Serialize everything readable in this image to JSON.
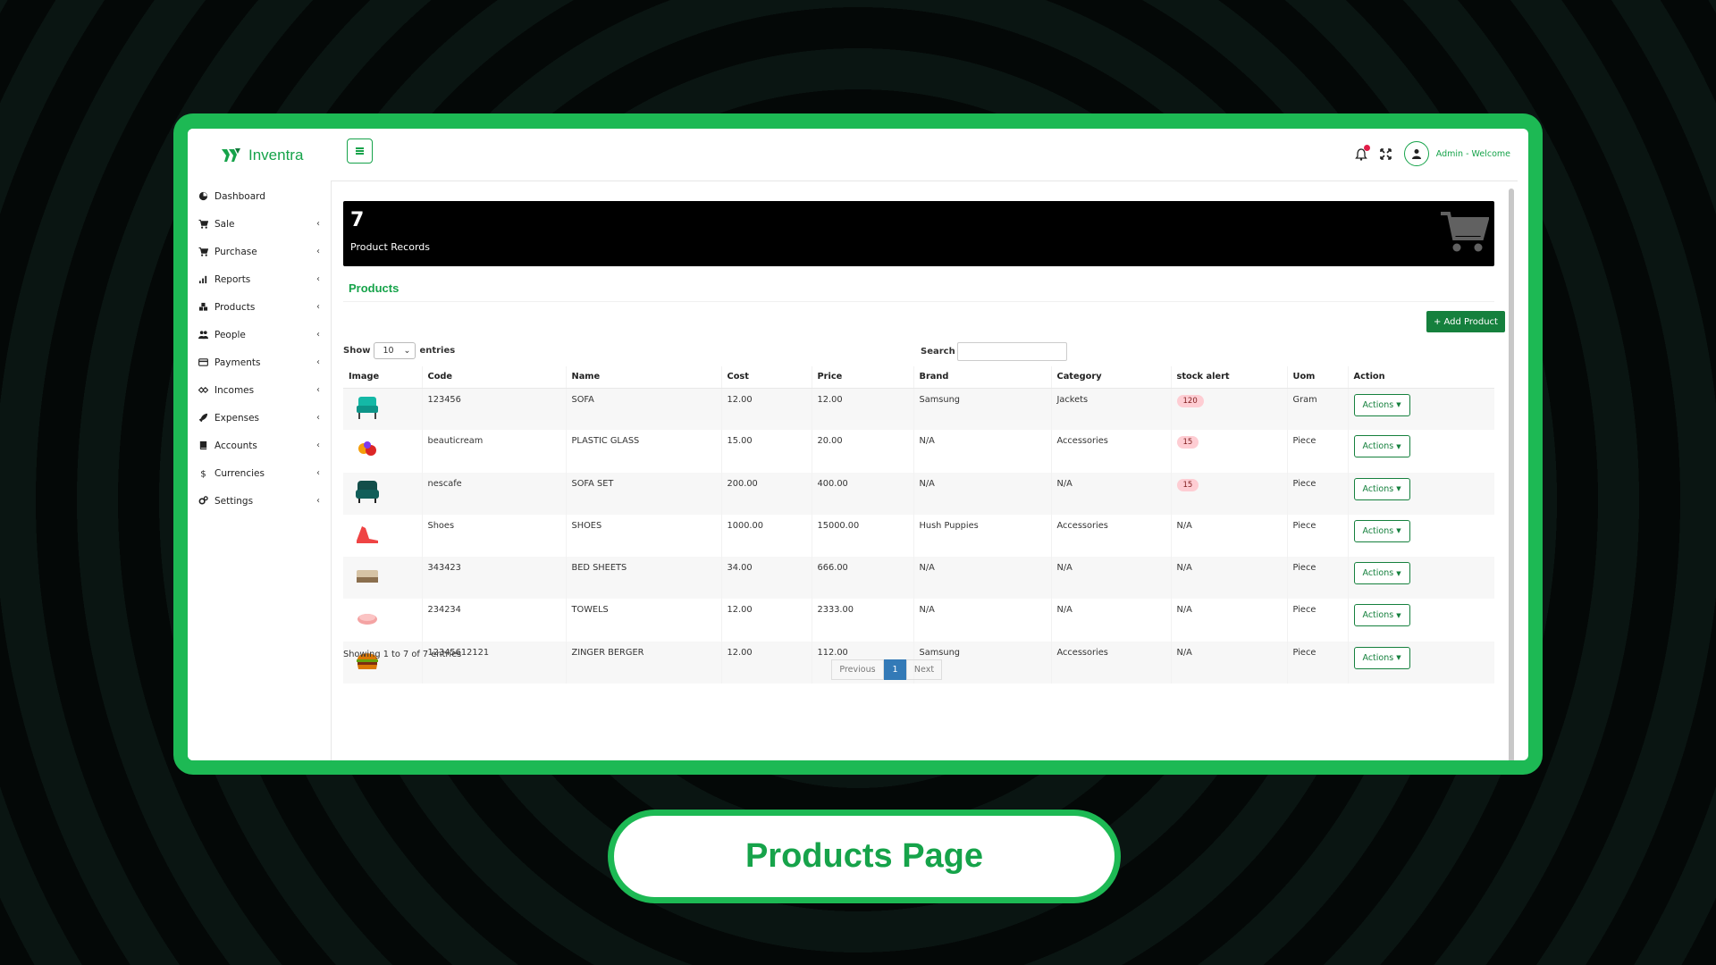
{
  "app": {
    "name": "Inventra"
  },
  "header": {
    "user_label": "Admin - Welcome"
  },
  "sidebar": {
    "items": [
      {
        "label": "Dashboard",
        "icon": "dashboard-icon",
        "chevron": ""
      },
      {
        "label": "Sale",
        "icon": "cart-icon",
        "chevron": "‹"
      },
      {
        "label": "Purchase",
        "icon": "cart-icon",
        "chevron": "‹"
      },
      {
        "label": "Reports",
        "icon": "bar-chart-icon",
        "chevron": "‹"
      },
      {
        "label": "Products",
        "icon": "cubes-icon",
        "chevron": "‹"
      },
      {
        "label": "People",
        "icon": "users-icon",
        "chevron": "‹"
      },
      {
        "label": "Payments",
        "icon": "credit-card-icon",
        "chevron": "‹"
      },
      {
        "label": "Incomes",
        "icon": "handshake-icon",
        "chevron": "‹"
      },
      {
        "label": "Expenses",
        "icon": "rocket-icon",
        "chevron": "‹"
      },
      {
        "label": "Accounts",
        "icon": "book-icon",
        "chevron": "‹"
      },
      {
        "label": "Currencies",
        "icon": "dollar-icon",
        "chevron": "‹"
      },
      {
        "label": "Settings",
        "icon": "gears-icon",
        "chevron": "‹"
      }
    ]
  },
  "summary": {
    "count": "7",
    "label": "Product Records"
  },
  "products": {
    "title": "Products",
    "add_label": "Add Product",
    "show_label": "Show",
    "entries_value": "10",
    "entries_label": "entries",
    "search_label": "Search",
    "columns": [
      "Image",
      "Code",
      "Name",
      "Cost",
      "Price",
      "Brand",
      "Category",
      "stock alert",
      "Uom",
      "Action"
    ],
    "rows": [
      {
        "image": "blue-armchair",
        "code": "123456",
        "name": "SOFA",
        "cost": "12.00",
        "price": "12.00",
        "brand": "Samsung",
        "category": "Jackets",
        "stock": "120",
        "stock_badge": true,
        "uom": "Gram",
        "action": "Actions"
      },
      {
        "image": "colorful-items",
        "code": "beauticream",
        "name": "PLASTIC GLASS",
        "cost": "15.00",
        "price": "20.00",
        "brand": "N/A",
        "category": "Accessories",
        "stock": "15",
        "stock_badge": true,
        "uom": "Piece",
        "action": "Actions"
      },
      {
        "image": "green-armchair",
        "code": "nescafe",
        "name": "SOFA SET",
        "cost": "200.00",
        "price": "400.00",
        "brand": "N/A",
        "category": "N/A",
        "stock": "15",
        "stock_badge": true,
        "uom": "Piece",
        "action": "Actions"
      },
      {
        "image": "red-shoes",
        "code": "Shoes",
        "name": "SHOES",
        "cost": "1000.00",
        "price": "15000.00",
        "brand": "Hush Puppies",
        "category": "Accessories",
        "stock": "N/A",
        "stock_badge": false,
        "uom": "Piece",
        "action": "Actions"
      },
      {
        "image": "bed-sheets",
        "code": "343423",
        "name": "BED SHEETS",
        "cost": "34.00",
        "price": "666.00",
        "brand": "N/A",
        "category": "N/A",
        "stock": "N/A",
        "stock_badge": false,
        "uom": "Piece",
        "action": "Actions"
      },
      {
        "image": "towels",
        "code": "234234",
        "name": "TOWELS",
        "cost": "12.00",
        "price": "2333.00",
        "brand": "N/A",
        "category": "N/A",
        "stock": "N/A",
        "stock_badge": false,
        "uom": "Piece",
        "action": "Actions"
      },
      {
        "image": "burger",
        "code": "12345612121",
        "name": "ZINGER BERGER",
        "cost": "12.00",
        "price": "112.00",
        "brand": "Samsung",
        "category": "Accessories",
        "stock": "N/A",
        "stock_badge": false,
        "uom": "Piece",
        "action": "Actions"
      }
    ],
    "showing_text": "Showing 1 to 7 of 7 entries",
    "pager": {
      "previous": "Previous",
      "current": "1",
      "next": "Next"
    }
  },
  "caption": "Products Page",
  "colors": {
    "accent": "#16a34a",
    "frame": "#1db954",
    "badge": "#fecdd3",
    "pager_active": "#337ab7"
  }
}
